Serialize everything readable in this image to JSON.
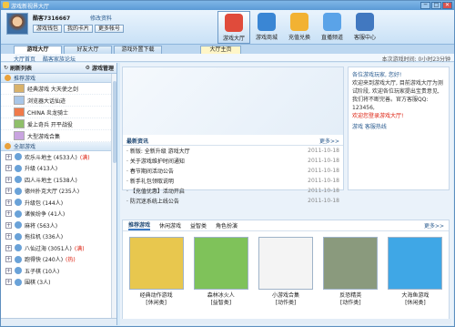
{
  "window": {
    "title": "游戏新视界大厅",
    "buttons": [
      "─",
      "□",
      "✕"
    ]
  },
  "user": {
    "name": "酷客7316667",
    "link": "修改资料",
    "buttons": [
      "游戏钱包",
      "我的卡片",
      "更多帐号"
    ]
  },
  "toolbar": [
    {
      "label": "游戏大厅",
      "color": "#e04b3b"
    },
    {
      "label": "游戏商城",
      "color": "#3a86d4"
    },
    {
      "label": "充值兑换",
      "color": "#f2b233"
    },
    {
      "label": "直播频道",
      "color": "#5aa3e8"
    },
    {
      "label": "客服中心",
      "color": "#4178c0"
    }
  ],
  "tabs": [
    "游戏大厅",
    "好友大厅",
    "游戏外置下载",
    "大厅主页"
  ],
  "subnav": {
    "left": [
      "大厅首页",
      "酷客家族论坛"
    ],
    "right": "本次游戏时间: 0小时23分钟"
  },
  "left": {
    "header_left": "刷新列表",
    "header_right": "游戏管理",
    "section_recommended": "推荐游戏",
    "recommended": [
      "经典游戏 大天使之剑",
      "浏览器大话仙迹",
      "CHINA 炎龙骑士",
      "爱上奇兵 开平战役",
      "大型游戏合集"
    ],
    "section_all": "全部游戏",
    "servers": [
      {
        "name": "欢乐斗地主 (4533人)",
        "hot": "(满)"
      },
      {
        "name": "升级 (413人)",
        "hot": ""
      },
      {
        "name": "四人斗地主 (1538人)",
        "hot": ""
      },
      {
        "name": "德州扑克大厅 (235人)",
        "hot": ""
      },
      {
        "name": "升级包 (144人)",
        "hot": ""
      },
      {
        "name": "诸侯纷争 (41人)",
        "hot": ""
      },
      {
        "name": "麻将 (563人)",
        "hot": ""
      },
      {
        "name": "拖拉机 (336人)",
        "hot": ""
      },
      {
        "name": "八仙过海 (3051人)",
        "hot": "(满)"
      },
      {
        "name": "跑得快 (240人)",
        "hot": "(热)"
      },
      {
        "name": "五子棋 (10人)",
        "hot": ""
      },
      {
        "name": "围棋 (3人)",
        "hot": ""
      }
    ]
  },
  "news": {
    "title": "最新资讯",
    "more": "更多>>",
    "items": [
      {
        "t": "· 新版: 全新升级 游戏大厅",
        "d": "2011-10-18"
      },
      {
        "t": "· 关于游戏维护时间通知",
        "d": "2011-10-18"
      },
      {
        "t": "· 春节期间活动公告",
        "d": "2011-10-18"
      },
      {
        "t": "· 新手礼包领取说明",
        "d": "2011-10-18"
      },
      {
        "t": "· 【充值优惠】活动开启",
        "d": "2011-10-18"
      },
      {
        "t": "· 防沉迷系统上线公告",
        "d": "2011-10-18"
      }
    ]
  },
  "notice": {
    "title": "各位游戏玩家, 您好!",
    "body": "欢迎来到游戏大厅, 目前游戏大厅为测试阶段, 欢迎各位玩家提出宝贵意见, 我们将不断完善。官方客服QQ: 123456,",
    "red": "欢迎您登录游戏大厅!",
    "footer": "游戏 客服热线"
  },
  "games": {
    "tabs": [
      "推荐游戏",
      "休闲游戏",
      "益智类",
      "角色扮演"
    ],
    "more": "更多>>",
    "cards": [
      {
        "name": "经典动作游戏",
        "sub": "[休闲类]",
        "color": "#e8c74e"
      },
      {
        "name": "森林冰火人",
        "sub": "[益智类]",
        "color": "#7fc25a"
      },
      {
        "name": "小游戏合集",
        "sub": "[动作类]",
        "color": "#f4f4f4"
      },
      {
        "name": "反恐精英",
        "sub": "[动作类]",
        "color": "#8a9a7d"
      },
      {
        "name": "大海鱼游戏",
        "sub": "[休闲类]",
        "color": "#3fa7e6"
      }
    ]
  }
}
